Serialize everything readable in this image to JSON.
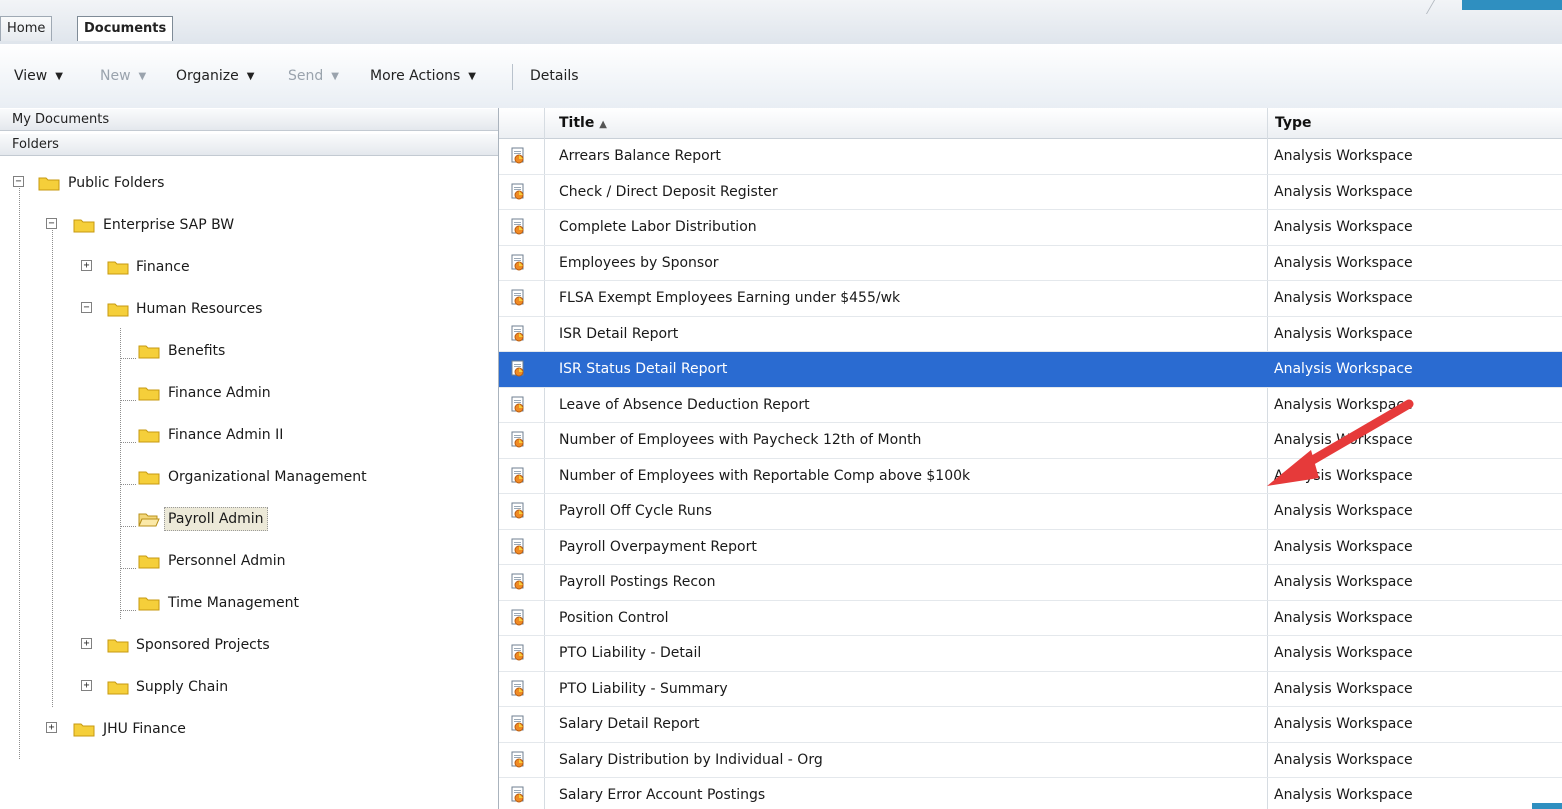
{
  "tabs": [
    {
      "label": "Home",
      "active": false
    },
    {
      "label": "Documents",
      "active": true
    }
  ],
  "toolbar": {
    "items": [
      {
        "label": "View",
        "caret": "▼",
        "disabled": false
      },
      {
        "label": "New",
        "caret": "▼",
        "disabled": true
      },
      {
        "label": "Organize",
        "caret": "▼",
        "disabled": false
      },
      {
        "label": "Send",
        "caret": "▼",
        "disabled": true
      },
      {
        "label": "More Actions",
        "caret": "▼",
        "disabled": false
      },
      {
        "label": "Details",
        "caret": "",
        "disabled": false
      }
    ]
  },
  "left": {
    "my_documents": "My Documents",
    "folders": "Folders",
    "tree": [
      {
        "label": "Public Folders",
        "expander": "−"
      },
      {
        "label": "Enterprise SAP BW",
        "expander": "−"
      },
      {
        "label": "Finance",
        "expander": "+"
      },
      {
        "label": "Human Resources",
        "expander": "−"
      },
      {
        "label": "Benefits",
        "expander": ""
      },
      {
        "label": "Finance Admin",
        "expander": ""
      },
      {
        "label": "Finance Admin II",
        "expander": ""
      },
      {
        "label": "Organizational Management",
        "expander": ""
      },
      {
        "label": "Payroll Admin",
        "expander": "",
        "selected": true
      },
      {
        "label": "Personnel Admin",
        "expander": ""
      },
      {
        "label": "Time Management",
        "expander": ""
      },
      {
        "label": "Sponsored Projects",
        "expander": "+"
      },
      {
        "label": "Supply Chain",
        "expander": "+"
      },
      {
        "label": "JHU Finance",
        "expander": "+"
      }
    ]
  },
  "grid": {
    "columns": {
      "title": "Title",
      "sort_glyph": "▲",
      "type": "Type"
    },
    "rows": [
      {
        "title": "Arrears Balance Report",
        "type": "Analysis Workspace"
      },
      {
        "title": "Check / Direct Deposit Register",
        "type": "Analysis Workspace"
      },
      {
        "title": "Complete Labor Distribution",
        "type": "Analysis Workspace"
      },
      {
        "title": "Employees by Sponsor",
        "type": "Analysis Workspace"
      },
      {
        "title": "FLSA Exempt Employees Earning under $455/wk",
        "type": "Analysis Workspace"
      },
      {
        "title": "ISR Detail Report",
        "type": "Analysis Workspace"
      },
      {
        "title": "ISR Status Detail Report",
        "type": "Analysis Workspace",
        "selected": true
      },
      {
        "title": "Leave of Absence Deduction Report",
        "type": "Analysis Workspace"
      },
      {
        "title": "Number of Employees with Paycheck 12th of Month",
        "type": "Analysis Workspace"
      },
      {
        "title": "Number of Employees with Reportable Comp above $100k",
        "type": "Analysis Workspace"
      },
      {
        "title": "Payroll Off Cycle Runs",
        "type": "Analysis Workspace"
      },
      {
        "title": "Payroll Overpayment Report",
        "type": "Analysis Workspace"
      },
      {
        "title": "Payroll Postings Recon",
        "type": "Analysis Workspace"
      },
      {
        "title": "Position Control",
        "type": "Analysis Workspace"
      },
      {
        "title": "PTO Liability - Detail",
        "type": "Analysis Workspace"
      },
      {
        "title": "PTO Liability - Summary",
        "type": "Analysis Workspace"
      },
      {
        "title": "Salary Detail Report",
        "type": "Analysis Workspace"
      },
      {
        "title": "Salary Distribution by Individual - Org",
        "type": "Analysis Workspace"
      },
      {
        "title": "Salary Error Account Postings",
        "type": "Analysis Workspace"
      }
    ]
  },
  "colors": {
    "selection": "#2a6bd1",
    "arrow": "#e63a3a",
    "folder": "#f5cf3a",
    "accent": "#2f8fc0"
  },
  "icons": {
    "folder": "folder-icon",
    "open_folder": "folder-open-icon",
    "document": "analysis-workspace-document-icon"
  }
}
